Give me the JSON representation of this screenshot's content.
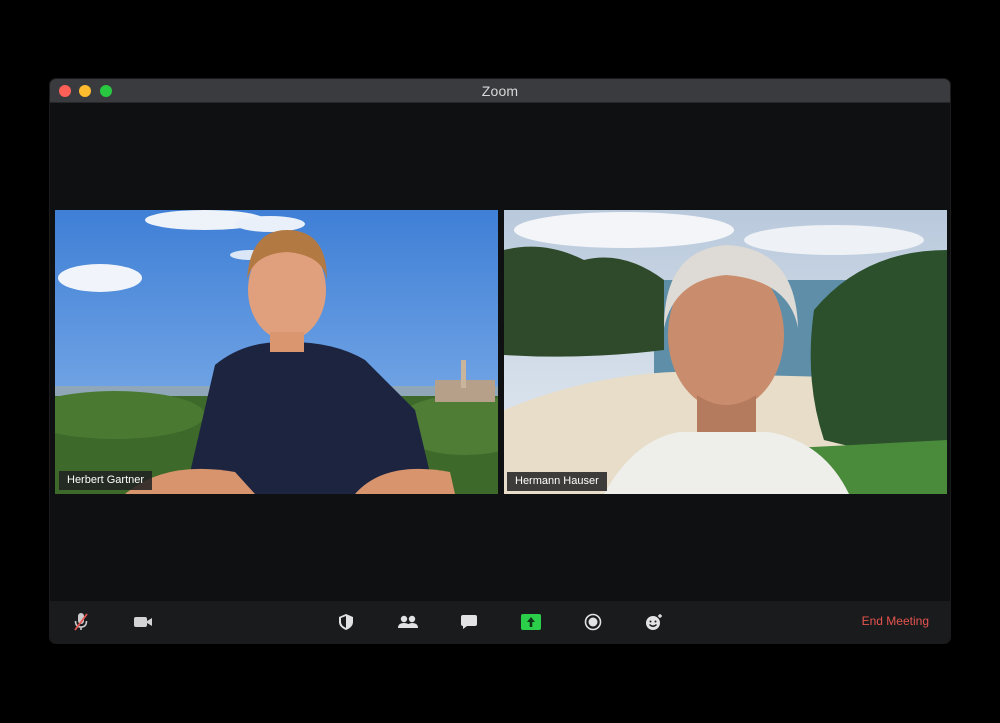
{
  "window": {
    "title": "Zoom"
  },
  "participants": [
    {
      "name": "Herbert Gartner",
      "active_speaker": true
    },
    {
      "name": "Hermann Hauser",
      "active_speaker": false
    }
  ],
  "toolbar": {
    "buttons": [
      {
        "icon": "microphone-muted-icon"
      },
      {
        "icon": "video-camera-icon"
      },
      {
        "icon": "shield-icon"
      },
      {
        "icon": "participants-icon"
      },
      {
        "icon": "chat-icon"
      },
      {
        "icon": "share-screen-icon"
      },
      {
        "icon": "record-icon"
      },
      {
        "icon": "reactions-icon"
      }
    ],
    "end_meeting_label": "End Meeting"
  },
  "colors": {
    "active_speaker_border": "#c8e36a",
    "share_screen_green": "#2ccf4a",
    "end_meeting_red": "#e5544f"
  }
}
